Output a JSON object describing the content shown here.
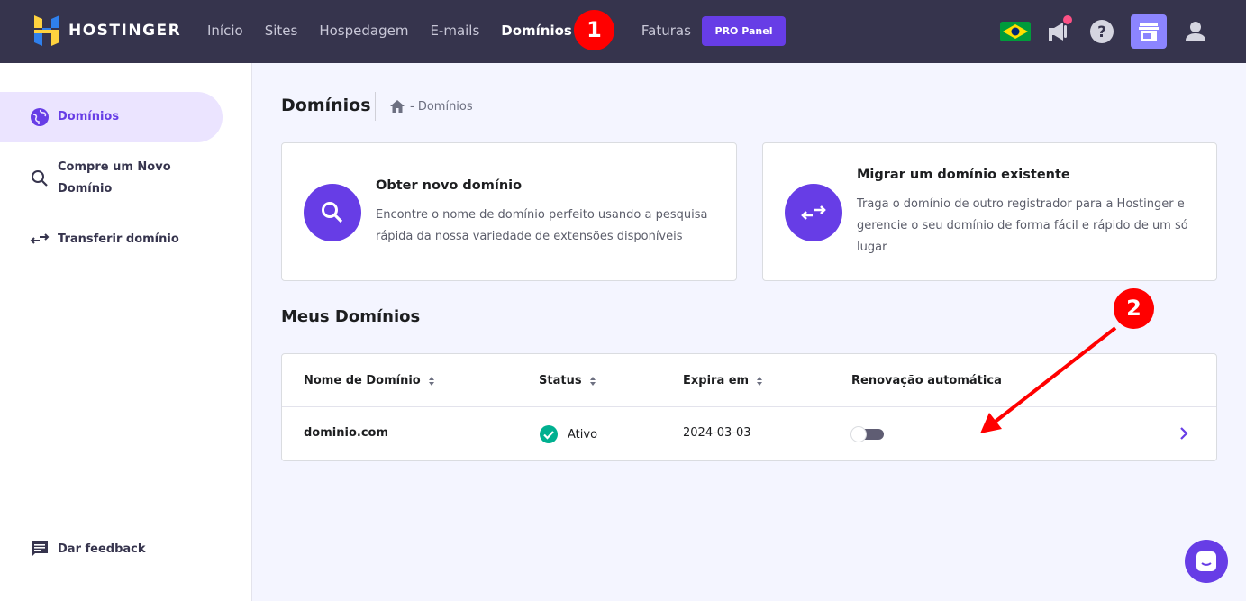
{
  "brand": {
    "name": "HOSTINGER"
  },
  "nav": {
    "items": [
      {
        "label": "Início"
      },
      {
        "label": "Sites"
      },
      {
        "label": "Hospedagem"
      },
      {
        "label": "E-mails"
      },
      {
        "label": "Domínios",
        "active": true
      },
      {
        "label": "Faturas"
      }
    ],
    "pro_button": "PRO Panel"
  },
  "markers": {
    "first": "1",
    "second": "2"
  },
  "sidebar": {
    "items": [
      {
        "label": "Domínios",
        "icon": "globe-icon",
        "active": true
      },
      {
        "label": "Compre um Novo Domínio",
        "line1": "Compre um Novo",
        "line2": "Domínio",
        "icon": "search-icon"
      },
      {
        "label": "Transferir domínio",
        "icon": "transfer-icon"
      }
    ],
    "feedback": "Dar feedback"
  },
  "page": {
    "title": "Domínios",
    "breadcrumb": "- Domínios"
  },
  "cards": [
    {
      "title": "Obter novo domínio",
      "line1": "Encontre o nome de domínio perfeito usando a pesquisa",
      "line2": "rápida da nossa variedade de extensões disponíveis",
      "icon": "search-icon"
    },
    {
      "title": "Migrar um domínio existente",
      "line1": "Traga o domínio de outro registrador para a Hostinger e",
      "line2": "gerencie o seu domínio de forma fácil e rápido de um só",
      "line3": "lugar",
      "icon": "transfer-icon"
    }
  ],
  "my_domains": {
    "title": "Meus Domínios",
    "columns": [
      "Nome de Domínio",
      "Status",
      "Expira em",
      "Renovação automática"
    ],
    "rows": [
      {
        "domain": "dominio.com",
        "status": "Ativo",
        "expires": "2024-03-03",
        "auto_renew": false
      }
    ]
  },
  "colors": {
    "topbar": "#36344d",
    "accent": "#673de6",
    "marker": "#ff0000",
    "status_ok": "#00b090"
  }
}
